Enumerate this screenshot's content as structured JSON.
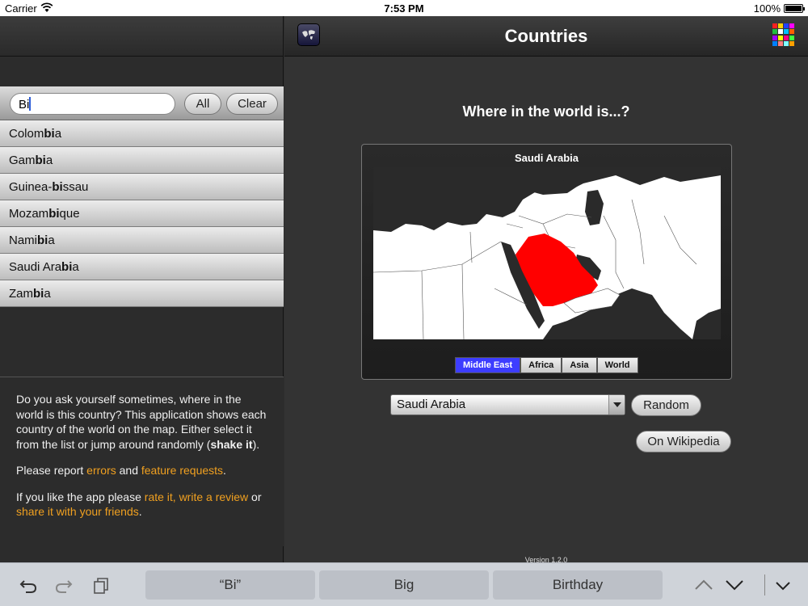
{
  "status_bar": {
    "carrier": "Carrier",
    "time": "7:53 PM",
    "battery": "100%"
  },
  "sidebar": {
    "search": {
      "value": "Bi"
    },
    "all_label": "All",
    "clear_label": "Clear",
    "results": [
      {
        "pre": "Colom",
        "match": "bi",
        "post": "a"
      },
      {
        "pre": "Gam",
        "match": "bi",
        "post": "a"
      },
      {
        "pre": "Guinea-",
        "match": "bi",
        "post": "ssau"
      },
      {
        "pre": "Mozam",
        "match": "bi",
        "post": "que"
      },
      {
        "pre": "Nami",
        "match": "bi",
        "post": "a"
      },
      {
        "pre": "Saudi Ara",
        "match": "bi",
        "post": "a"
      },
      {
        "pre": "Zam",
        "match": "bi",
        "post": "a"
      }
    ],
    "about": {
      "p1_text": "Do you ask yourself sometimes, where in the world is this country? This application shows each country of the world on the map. Either select it from the list or jump around randomly (",
      "p1_bold": "shake it",
      "p1_end": ").",
      "p2_pre": "Please report ",
      "p2_link1": "errors",
      "p2_mid": " and ",
      "p2_link2": "feature requests",
      "p2_end": ".",
      "p3_pre": "If you like the app please ",
      "p3_link1": "rate it, write a review",
      "p3_mid": " or ",
      "p3_link2": "share it with your friends",
      "p3_end": "."
    }
  },
  "main": {
    "title": "Countries",
    "question": "Where in the world is...?",
    "map_title": "Saudi Arabia",
    "region_tabs": [
      "Middle East",
      "Africa",
      "Asia",
      "World"
    ],
    "active_region": "Middle East",
    "selected_country": "Saudi Arabia",
    "random_label": "Random",
    "wikipedia_label": "On Wikipedia",
    "version": "Version 1.2.0",
    "highlight_color": "#ff0000",
    "icon_colors": [
      "#ff2020",
      "#ffd000",
      "#2040ff",
      "#ff00ff",
      "#20c040",
      "#ffffff",
      "#00c0ff",
      "#ff6000",
      "#a000ff",
      "#ffff00",
      "#ff0080",
      "#40ff40",
      "#0080ff",
      "#ff8080",
      "#80ffff",
      "#ffa000"
    ]
  },
  "keyboard_bar": {
    "suggestions": [
      "“Bi”",
      "Big",
      "Birthday"
    ],
    "icons": [
      "undo-icon",
      "redo-icon",
      "paste-icon",
      "chevron-up-icon",
      "chevron-down-icon",
      "keyboard-dismiss-icon"
    ]
  }
}
